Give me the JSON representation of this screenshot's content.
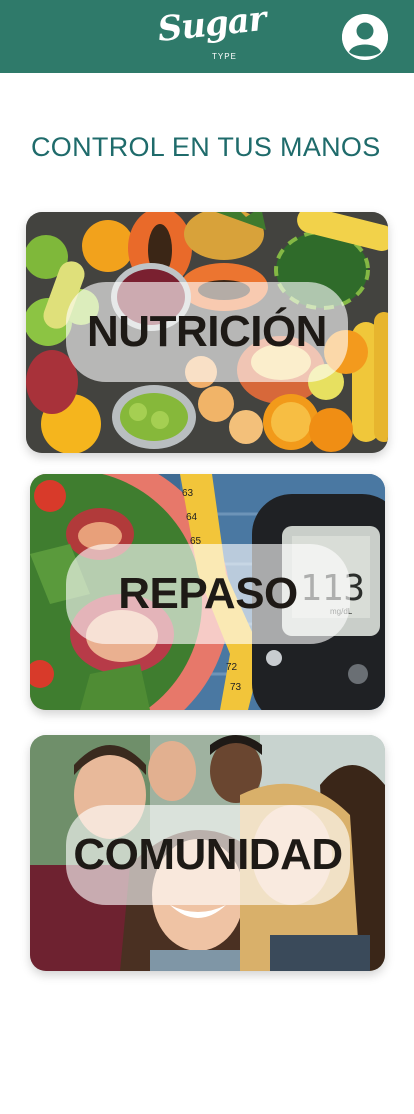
{
  "header": {
    "logo_text": "Sugar",
    "logo_subtext": "TYPE",
    "profile_icon": "user-circle-icon",
    "background_color": "#2f7a6a"
  },
  "main": {
    "headline": "CONTROL EN TUS MANOS",
    "headline_color": "#1f6b6b",
    "cards": [
      {
        "label": "NUTRICIÓN",
        "image": "fruits-photo"
      },
      {
        "label": "REPASO",
        "image": "glucose-meter-photo"
      },
      {
        "label": "COMUNIDAD",
        "image": "group-of-friends-photo"
      }
    ]
  }
}
